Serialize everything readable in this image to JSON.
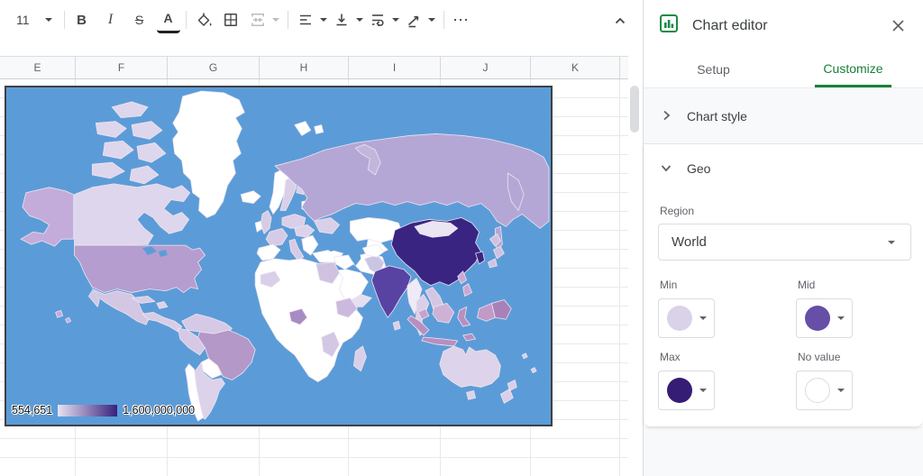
{
  "toolbar": {
    "font_size": "11",
    "bold": "B",
    "italic": "I",
    "strikethrough": "S",
    "text_color": "A",
    "more": "⋯"
  },
  "sheet": {
    "columns": [
      "E",
      "F",
      "G",
      "H",
      "I",
      "J",
      "K"
    ]
  },
  "chart_editor": {
    "title": "Chart editor",
    "tabs": [
      {
        "label": "Setup",
        "active": false
      },
      {
        "label": "Customize",
        "active": true
      }
    ],
    "sections": [
      {
        "label": "Chart style",
        "state": "collapsed"
      },
      {
        "label": "Geo",
        "state": "expanded"
      }
    ],
    "geo": {
      "region_label": "Region",
      "region_value": "World",
      "min_label": "Min",
      "mid_label": "Mid",
      "max_label": "Max",
      "no_value_label": "No value",
      "min_color": "#d9d2e9",
      "mid_color": "#674ea7",
      "max_color": "#351c75",
      "no_value_color": "#ffffff"
    },
    "accent_green": "#188038"
  },
  "chart_data": {
    "type": "choropleth_geo",
    "region_scope": "World",
    "legend": {
      "min_label": "554,651",
      "max_label": "1,600,000,000",
      "gradient_from": "#e7e2f2",
      "gradient_to": "#38217d"
    },
    "colors": {
      "ocean": "#5b9cd8",
      "min": "#d9d2e9",
      "mid": "#674ea7",
      "max": "#351c75",
      "no_value": "#ffffff"
    },
    "regions": {
      "ocean": "#5b9cd8",
      "greenland": "#ffffff",
      "canada": "#ded6ec",
      "alaska": "#c3acda",
      "usa": "#b59dcf",
      "hawaii": "#c3acda",
      "mexico": "#d4c7e4",
      "central_america": "#d8cde7",
      "cuba": "#d8cde7",
      "hispaniola": "#dcd2ea",
      "colombia_venezuela": "#d5c9e5",
      "peru": "#d5c9e5",
      "brazil": "#b398c8",
      "bolivia": "#ffffff",
      "argentina": "#dcd2ea",
      "chile": "#ffffff",
      "iceland": "#ffffff",
      "uk": "#d7cce6",
      "ireland": "#ffffff",
      "norway": "#ffffff",
      "sweden": "#d9cfe8",
      "finland": "#d9cfe8",
      "baltics": "#ffffff",
      "germany_poland": "#d9cfe8",
      "france": "#d6cbe6",
      "iberia": "#ffffff",
      "italy": "#d6cbe6",
      "central_europe": "#dcd3ea",
      "balkans": "#ffffff",
      "ukraine": "#d9cfe8",
      "turkey": "#ffffff",
      "russia": "#b5a7d5",
      "svalbard": "#ffffff",
      "novaya_zemlya": "#c3b6dc",
      "kazakhstan": "#ffffff",
      "central_asia": "#ffffff",
      "iran": "#ffffff",
      "iraq_syria": "#ffffff",
      "saudi": "#ffffff",
      "yemen_oman": "#e6dff1",
      "africa_base": "#ffffff",
      "west_sahara": "#d9cfe8",
      "egypt": "#cfc2e1",
      "nigeria": "#a78cc4",
      "ethiopia": "#cbbade",
      "east_africa": "#d3c7e3",
      "madagascar": "#d9cfe8",
      "india": "#5843a2",
      "sri_lanka": "#d9cfe8",
      "pakistan": "#c9c6e4",
      "afghanistan": "#ffffff",
      "china": "#3a2482",
      "mongolia": "#eae5f3",
      "korea": "#3a2482",
      "japan": "#cfc2e1",
      "myanmar": "#efeaf6",
      "thailand": "#d9cfe8",
      "indochina": "#d3c7e3",
      "malaysia": "#c9a2cc",
      "indonesia": "#b78fc0",
      "borneo": "#cdb2d6",
      "philippines": "#c9a8d2",
      "new_guinea_west": "#c19ac8",
      "new_guinea_east": "#a781b8",
      "australia": "#ddd3ea",
      "new_zealand": "#d9cfe8",
      "pacific_islands": "#d9cfe8"
    }
  }
}
